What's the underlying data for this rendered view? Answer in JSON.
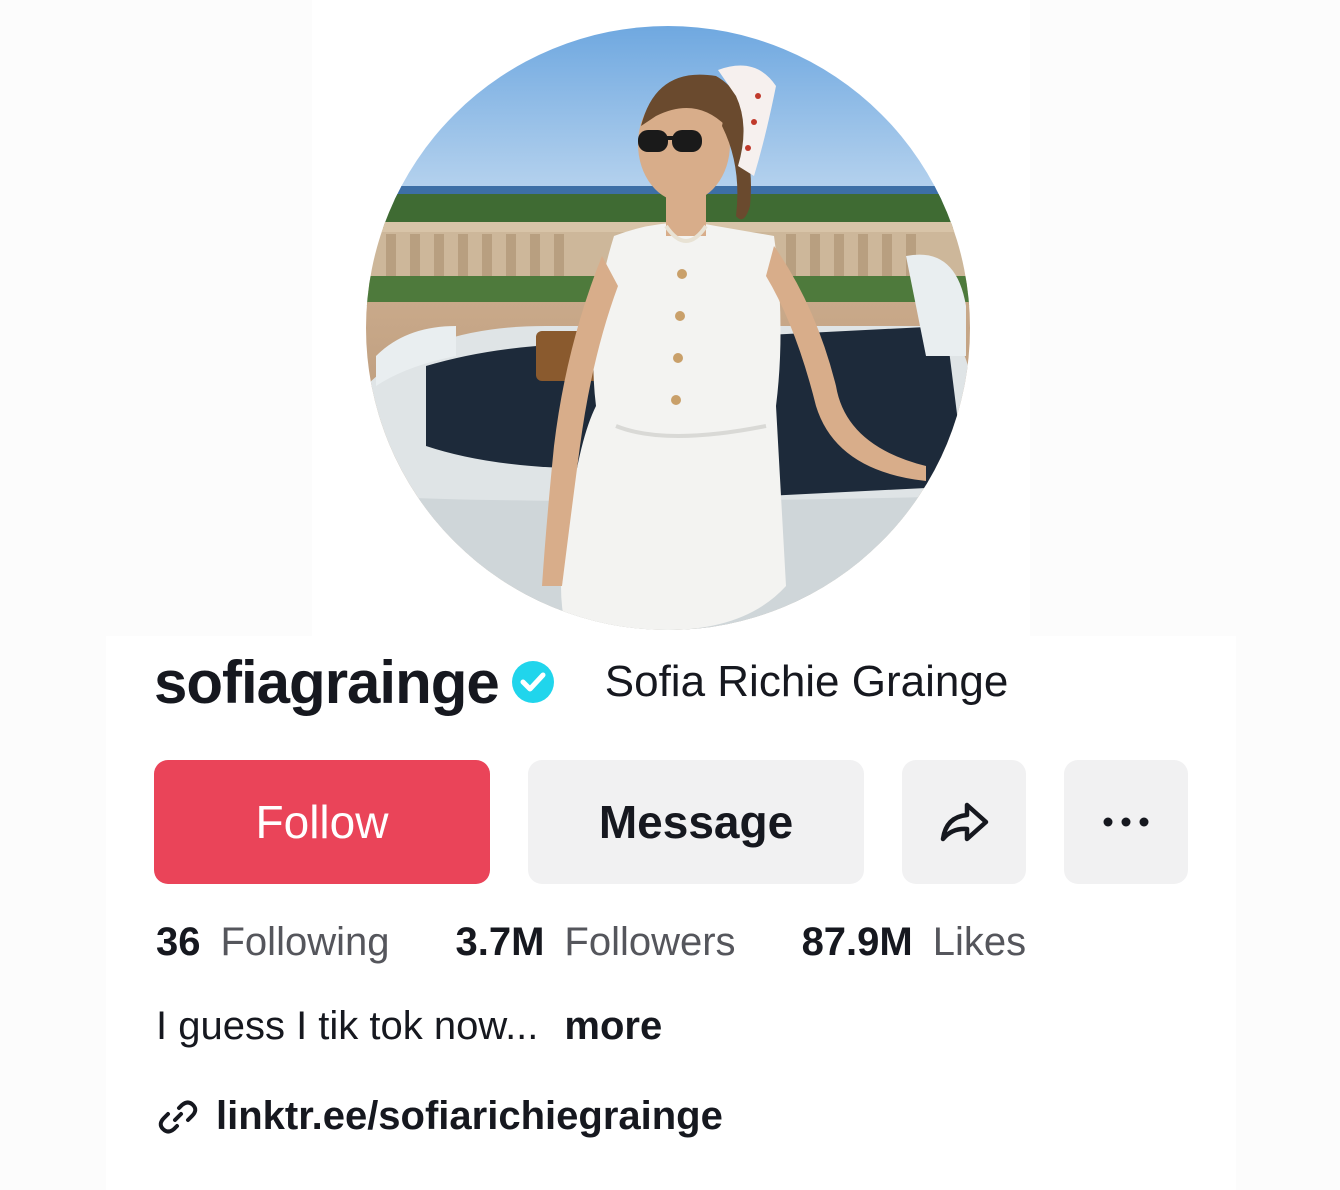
{
  "profile": {
    "username": "sofiagrainge",
    "display_name": "Sofia Richie Grainge",
    "verified": true,
    "avatar_alt": "Profile photo",
    "colors": {
      "follow": "#ea4459",
      "verified": "#20d5ec",
      "text": "#16181f",
      "secondary_text": "#55565c",
      "button_gray": "#f1f1f2"
    }
  },
  "actions": {
    "follow_label": "Follow",
    "message_label": "Message",
    "share_icon": "share-icon",
    "more_icon": "more-icon"
  },
  "stats": {
    "following": {
      "value": "36",
      "label": "Following"
    },
    "followers": {
      "value": "3.7M",
      "label": "Followers"
    },
    "likes": {
      "value": "87.9M",
      "label": "Likes"
    }
  },
  "bio": {
    "text": "I guess I tik tok now...",
    "more_label": "more"
  },
  "link": {
    "icon": "link-icon",
    "text": "linktr.ee/sofiarichiegrainge"
  }
}
